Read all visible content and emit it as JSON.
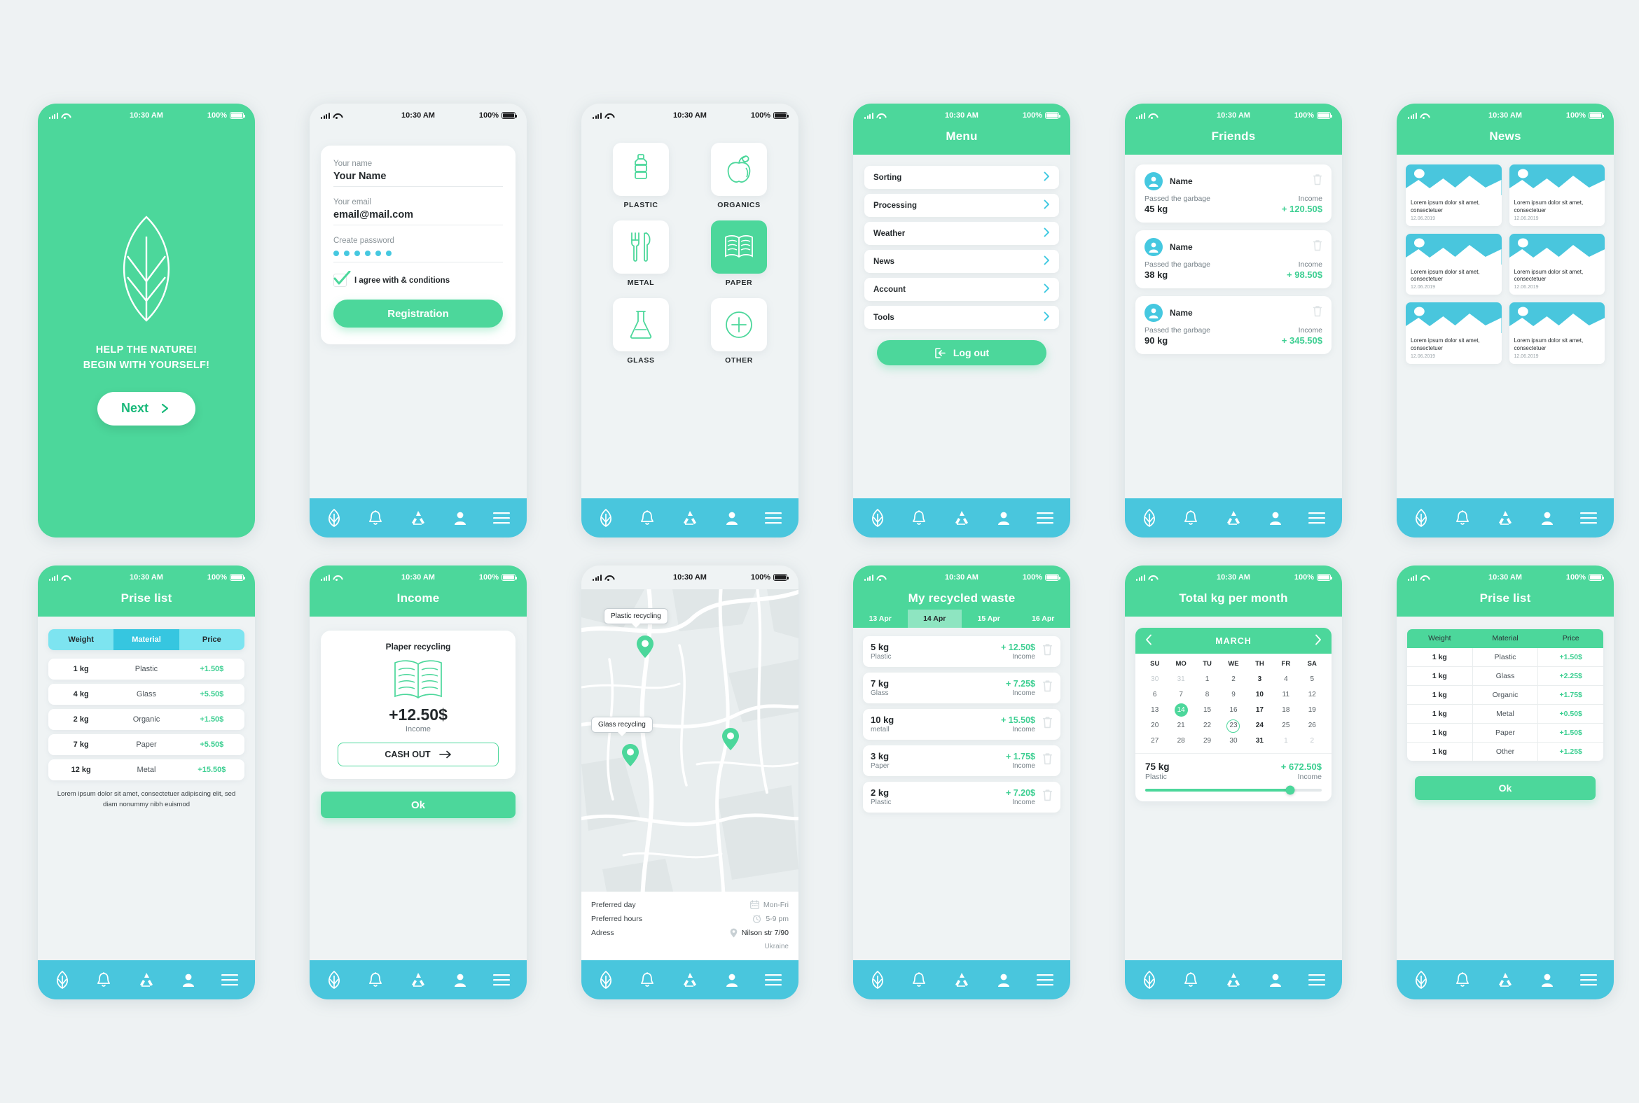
{
  "colors": {
    "green": "#4cd79b",
    "cyan": "#49c6dd",
    "bg": "#eef2f3",
    "dark": "#24292c",
    "muted": "#78838a"
  },
  "status_bar": {
    "time": "10:30 AM",
    "battery": "100%"
  },
  "screens": {
    "intro": {
      "tagline_line1": "HELP THE NATURE!",
      "tagline_line2": "BEGIN WITH YOURSELF!",
      "next_label": "Next"
    },
    "registration": {
      "name_label": "Your name",
      "name_value": "Your Name",
      "email_label": "Your email",
      "email_value": "email@mail.com",
      "password_label": "Create password",
      "password_value": "••••••",
      "agree_label": "I agree with & conditions",
      "submit_label": "Registration"
    },
    "categories": {
      "items": [
        {
          "label": "PLASTIC",
          "icon": "bottle-icon",
          "active": false
        },
        {
          "label": "ORGANICS",
          "icon": "apple-icon",
          "active": false
        },
        {
          "label": "METAL",
          "icon": "cutlery-icon",
          "active": false
        },
        {
          "label": "PAPER",
          "icon": "book-icon",
          "active": true
        },
        {
          "label": "GLASS",
          "icon": "flask-icon",
          "active": false
        },
        {
          "label": "OTHER",
          "icon": "plus-circle-icon",
          "active": false
        }
      ]
    },
    "menu": {
      "title": "Menu",
      "items": [
        "Sorting",
        "Processing",
        "Weather",
        "News",
        "Account",
        "Tools"
      ],
      "logout_label": "Log out"
    },
    "friends": {
      "title": "Friends",
      "passed_label": "Passed the garbage",
      "income_label": "Income",
      "items": [
        {
          "name": "Name",
          "weight": "45 kg",
          "income": "+ 120.50$"
        },
        {
          "name": "Name",
          "weight": "38 kg",
          "income": "+ 98.50$"
        },
        {
          "name": "Name",
          "weight": "90 kg",
          "income": "+ 345.50$"
        }
      ]
    },
    "news": {
      "title": "News",
      "items": [
        {
          "text": "Lorem ipsum dolor sit amet, consectetuer",
          "date": "12.06.2019"
        },
        {
          "text": "Lorem ipsum dolor sit amet, consectetuer",
          "date": "12.06.2019"
        },
        {
          "text": "Lorem ipsum dolor sit amet, consectetuer",
          "date": "12.06.2019"
        },
        {
          "text": "Lorem ipsum dolor sit amet, consectetuer",
          "date": "12.06.2019"
        },
        {
          "text": "Lorem ipsum dolor sit amet, consectetuer",
          "date": "12.06.2019"
        },
        {
          "text": "Lorem ipsum dolor sit amet, consectetuer",
          "date": "12.06.2019"
        }
      ]
    },
    "prise_list_pill": {
      "title": "Prise list",
      "headers": [
        "Weight",
        "Material",
        "Price"
      ],
      "selected_header": "Material",
      "rows": [
        {
          "weight": "1 kg",
          "material": "Plastic",
          "price": "+1.50$"
        },
        {
          "weight": "4 kg",
          "material": "Glass",
          "price": "+5.50$"
        },
        {
          "weight": "2 kg",
          "material": "Organic",
          "price": "+1.50$"
        },
        {
          "weight": "7 kg",
          "material": "Paper",
          "price": "+5.50$"
        },
        {
          "weight": "12 kg",
          "material": "Metal",
          "price": "+15.50$"
        }
      ],
      "note": "Lorem ipsum dolor sit amet, consectetuer adipiscing elit, sed diam nonummy nibh euismod"
    },
    "income": {
      "title": "Income",
      "card_title": "Plaper recycling",
      "amount": "+12.50$",
      "amount_label": "Income",
      "cashout_label": "CASH OUT",
      "ok_label": "Ok"
    },
    "map": {
      "bubble1": "Plastic recycling",
      "bubble2": "Glass recycling",
      "info": [
        {
          "key": "Preferred day",
          "icon": "calendar-icon",
          "value": "Mon-Fri"
        },
        {
          "key": "Preferred hours",
          "icon": "clock-icon",
          "value": "5-9 pm"
        },
        {
          "key": "Adress",
          "icon": "pin-icon",
          "value": "Nilson str 7/90"
        }
      ],
      "country": "Ukraine"
    },
    "recycled_waste": {
      "title": "My recycled waste",
      "days": [
        "13 Apr",
        "14 Apr",
        "15 Apr",
        "16 Apr"
      ],
      "selected_day": "14 Apr",
      "income_label": "Income",
      "items": [
        {
          "weight": "5 kg",
          "material": "Plastic",
          "income": "+  12.50$"
        },
        {
          "weight": "7 kg",
          "material": "Glass",
          "income": "+  7.25$"
        },
        {
          "weight": "10 kg",
          "material": "metall",
          "income": "+  15.50$"
        },
        {
          "weight": "3 kg",
          "material": "Paper",
          "income": "+  1.75$"
        },
        {
          "weight": "2 kg",
          "material": "Plastic",
          "income": "+  7.20$"
        }
      ]
    },
    "calendar": {
      "title": "Total kg per month",
      "month": "MARCH",
      "dow": [
        "SU",
        "MO",
        "TU",
        "WE",
        "TH",
        "FR",
        "SA"
      ],
      "weeks": [
        [
          {
            "d": "30",
            "s": "mut"
          },
          {
            "d": "31",
            "s": "mut"
          },
          {
            "d": "1"
          },
          {
            "d": "2"
          },
          {
            "d": "3",
            "s": "bold"
          },
          {
            "d": "4"
          },
          {
            "d": "5"
          }
        ],
        [
          {
            "d": "6"
          },
          {
            "d": "7"
          },
          {
            "d": "8"
          },
          {
            "d": "9"
          },
          {
            "d": "10",
            "s": "bold"
          },
          {
            "d": "11"
          },
          {
            "d": "12"
          }
        ],
        [
          {
            "d": "13"
          },
          {
            "d": "14",
            "s": "fill"
          },
          {
            "d": "15"
          },
          {
            "d": "16"
          },
          {
            "d": "17",
            "s": "bold"
          },
          {
            "d": "18"
          },
          {
            "d": "19"
          }
        ],
        [
          {
            "d": "20"
          },
          {
            "d": "21"
          },
          {
            "d": "22"
          },
          {
            "d": "23",
            "s": "ring"
          },
          {
            "d": "24",
            "s": "bold"
          },
          {
            "d": "25"
          },
          {
            "d": "26"
          }
        ],
        [
          {
            "d": "27"
          },
          {
            "d": "28"
          },
          {
            "d": "29"
          },
          {
            "d": "30"
          },
          {
            "d": "31",
            "s": "bold"
          },
          {
            "d": "1",
            "s": "mut"
          },
          {
            "d": "2",
            "s": "mut"
          }
        ]
      ],
      "summary_kg": "75 kg",
      "summary_material": "Plastic",
      "summary_income": "+ 672.50$",
      "summary_income_label": "Income"
    },
    "prise_list_table": {
      "title": "Prise list",
      "headers": [
        "Weight",
        "Material",
        "Price"
      ],
      "rows": [
        {
          "weight": "1 kg",
          "material": "Plastic",
          "price": "+1.50$"
        },
        {
          "weight": "1 kg",
          "material": "Glass",
          "price": "+2.25$"
        },
        {
          "weight": "1 kg",
          "material": "Organic",
          "price": "+1.75$"
        },
        {
          "weight": "1 kg",
          "material": "Metal",
          "price": "+0.50$"
        },
        {
          "weight": "1 kg",
          "material": "Paper",
          "price": "+1.50$"
        },
        {
          "weight": "1 kg",
          "material": "Other",
          "price": "+1.25$"
        }
      ],
      "ok_label": "Ok"
    }
  },
  "tabbar": {
    "icons": [
      "leaf-icon",
      "bell-icon",
      "recycle-icon",
      "user-icon",
      "hamburger-icon"
    ]
  }
}
